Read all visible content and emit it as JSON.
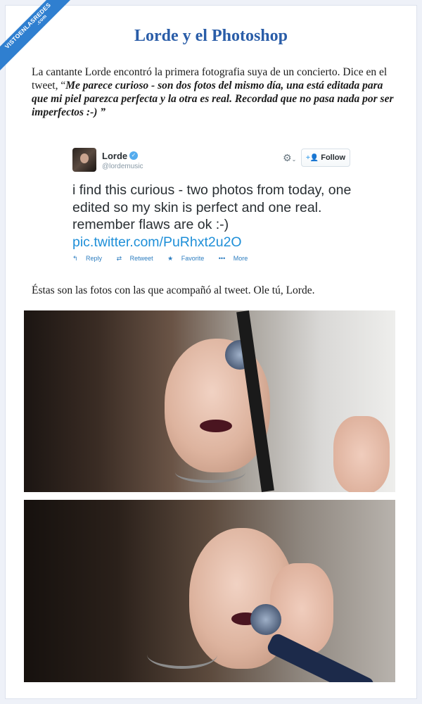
{
  "ribbon": {
    "line1": "VISTOENLASREDES",
    "line2": ".com"
  },
  "title": "Lorde y el Photoshop",
  "intro": {
    "plain": "La cantante Lorde encontró la primera fotografia suya de un concierto. Dice en el tweet, “",
    "quote": "Me parece curioso - son dos fotos del mismo día, una está editada para que mi piel parezca perfecta y la otra es real. Recordad que no pasa nada por ser imperfectos :-) ”"
  },
  "tweet": {
    "name": "Lorde",
    "handle": "@lordemusic",
    "follow_label": "Follow",
    "text": "i find this curious - two photos from today, one edited so my skin is perfect and one real. remember flaws are ok :-)",
    "link": "pic.twitter.com/PuRhxt2u2O",
    "actions": {
      "reply": "Reply",
      "retweet": "Retweet",
      "favorite": "Favorite",
      "more": "More"
    }
  },
  "caption": "Éstas son las fotos con las que acompañó al tweet. Ole tú, Lorde.",
  "icons": [
    "verified-icon",
    "gear-icon",
    "follow-user-icon",
    "reply-icon",
    "retweet-icon",
    "favorite-icon",
    "more-icon"
  ]
}
